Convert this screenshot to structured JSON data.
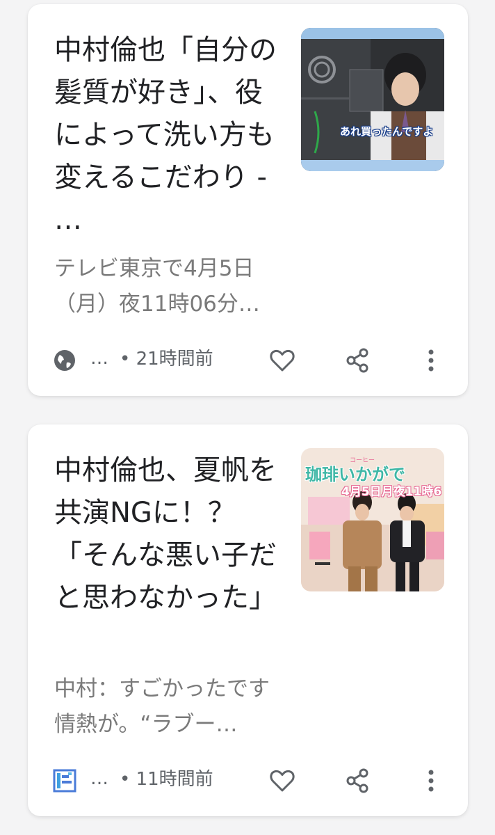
{
  "articles": [
    {
      "headline": "中村倫也「自分の髪質が好き」、役によって洗い方も変えるこだわり - …",
      "snippet": "テレビ東京で4月5日（月）夜11時06分…",
      "thumbnail_caption": "あれ買ったんですよ",
      "source_ellipsis": "…",
      "source_icon": "globe-icon",
      "time": "• 21時間前",
      "actions": [
        "heart-icon",
        "share-icon",
        "more-vert-icon"
      ]
    },
    {
      "headline": "中村倫也、夏帆を共演NGに！？「そんな悪い子だと思わなかった」",
      "snippet": "中村：すごかったです情熱が。“ラブー…",
      "thumbnail_title": "珈琲いかがで",
      "thumbnail_ruby": "コーヒー",
      "thumbnail_date": "4月5日月夜11時6",
      "source_ellipsis": "…",
      "source_icon": "site-logo-icon",
      "time": "• 11時間前",
      "actions": [
        "heart-icon",
        "share-icon",
        "more-vert-icon"
      ]
    }
  ],
  "colors": {
    "background": "#f4f4f5",
    "card": "#ffffff",
    "headline": "#202124",
    "snippet": "#7a7a7a",
    "meta": "#5f6368",
    "logo_blue": "#4a7bd8"
  }
}
